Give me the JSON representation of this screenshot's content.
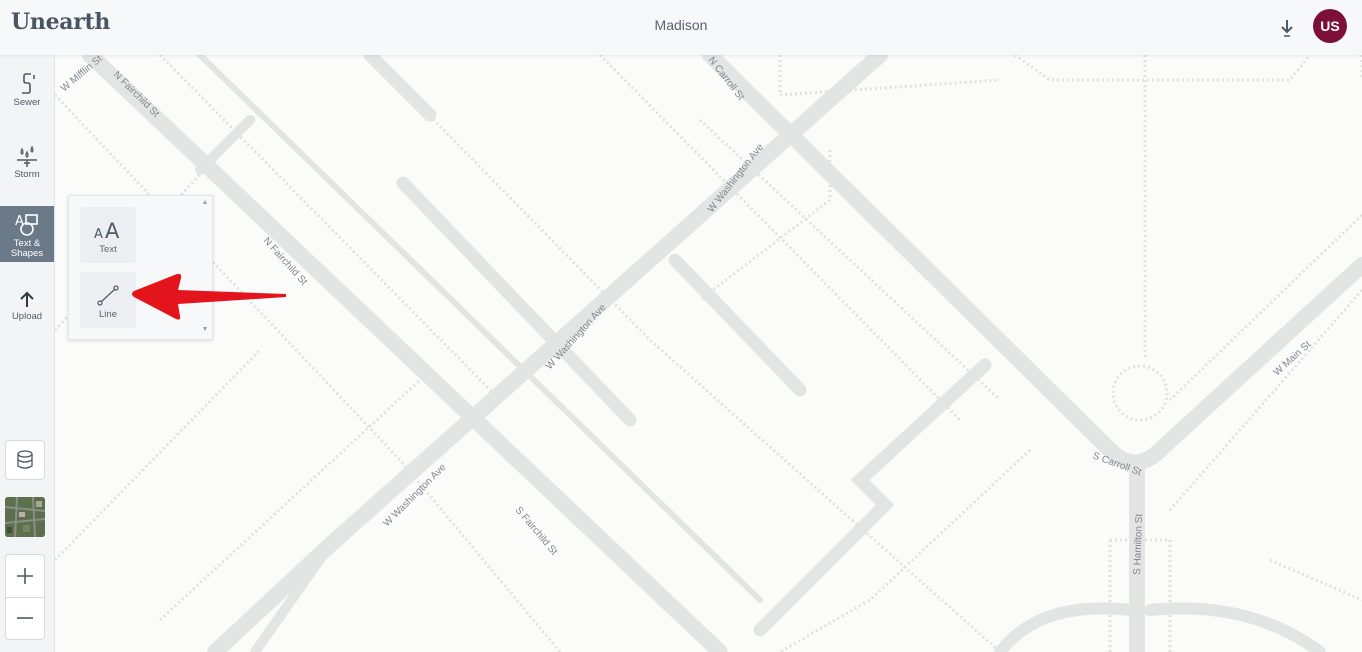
{
  "header": {
    "logo": "Unearth",
    "title": "Madison",
    "avatar_initials": "US"
  },
  "toolbar": {
    "tools": [
      {
        "label": "Sewer",
        "icon": "sewer-icon"
      },
      {
        "label": "Storm",
        "icon": "storm-icon"
      },
      {
        "label": "Text &\nShapes",
        "icon": "text-shapes-icon",
        "active": true
      },
      {
        "label": "Upload",
        "icon": "upload-icon"
      }
    ]
  },
  "popup": {
    "items": [
      {
        "label": "Text",
        "icon": "text-icon"
      },
      {
        "label": "Line",
        "icon": "line-icon"
      }
    ]
  },
  "map": {
    "streets": [
      "W Mifflin St",
      "N Fairchild St",
      "N Carroll St",
      "W Washington Ave",
      "N Fairchild St",
      "W Washington Ave",
      "W Main St",
      "S Carroll St",
      "W Washington Ave",
      "S Fairchild St",
      "S Hamilton St"
    ]
  },
  "colors": {
    "accent": "#7d1038",
    "road": "#e3e5e4",
    "active_tool": "#6b7a88",
    "arrow": "#e3141b"
  }
}
